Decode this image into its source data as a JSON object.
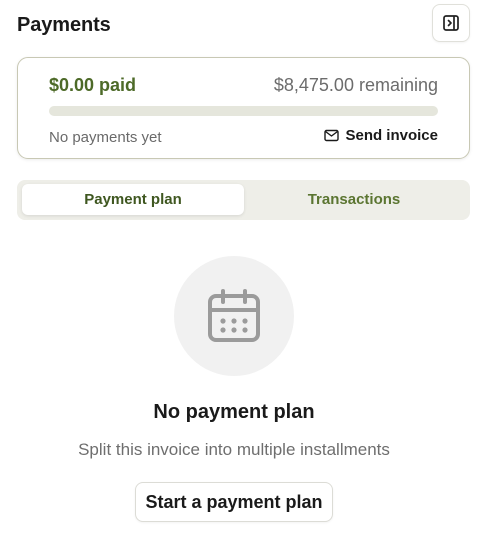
{
  "header": {
    "title": "Payments",
    "toggle_icon": "panel-right-icon"
  },
  "summary": {
    "paid": "$0.00 paid",
    "remaining": "$8,475.00 remaining",
    "progress_percent": 0,
    "status": "No payments yet",
    "send_invoice_label": "Send invoice",
    "send_invoice_icon": "mail-icon"
  },
  "tabs": [
    {
      "label": "Payment plan",
      "active": true
    },
    {
      "label": "Transactions",
      "active": false
    }
  ],
  "empty_state": {
    "icon": "calendar-icon",
    "title": "No payment plan",
    "subtitle": "Split this invoice into multiple installments",
    "cta_label": "Start a payment plan"
  },
  "colors": {
    "accent": "#4d6a28",
    "progress_track": "#e5e6dc",
    "tab_bar": "#eeeee8",
    "card_border": "#c8c8b4"
  }
}
